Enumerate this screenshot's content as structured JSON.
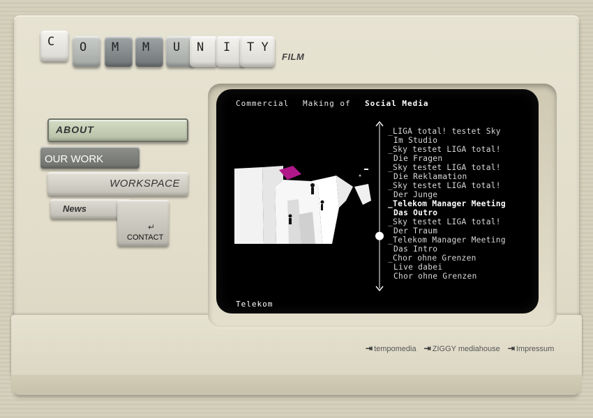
{
  "logo": {
    "letters": [
      "C",
      "O",
      "M",
      "M",
      "U",
      "N",
      "I",
      "T",
      "Y"
    ],
    "film": "FILM"
  },
  "nav": {
    "about": "ABOUT",
    "our_work": "OUR WORK",
    "workspace": "WORKSPACE",
    "news": "News",
    "contact": "CONTACT",
    "enter_glyph": "↵"
  },
  "screen": {
    "tabs": [
      "Commercial",
      "Making of",
      "Social Media"
    ],
    "active_tab": "Social Media",
    "caption": "Telekom",
    "playlist": [
      {
        "title": "_LIGA total! testet Sky",
        "sub": "Im Studio"
      },
      {
        "title": "_Sky testet LIGA total!",
        "sub": "Die Fragen"
      },
      {
        "title": "_Sky testet LIGA total!",
        "sub": "Die Reklamation"
      },
      {
        "title": "_Sky testet LIGA total!",
        "sub": "Der Junge"
      },
      {
        "title": "_Telekom Manager Meeting",
        "sub": "Das Outro",
        "active": true
      },
      {
        "title": "_Sky testet LIGA total!",
        "sub": "Der Traum"
      },
      {
        "title": "_Telekom Manager Meeting",
        "sub": "Das Intro"
      },
      {
        "title": "_Chor ohne Grenzen",
        "sub": "Live dabei"
      },
      {
        "title": "",
        "sub": "Chor ohne Grenzen"
      }
    ],
    "scroll_position": 0.71,
    "accent_color": "#b0188a"
  },
  "footer": {
    "links": [
      "tempomedia",
      "ZIGGY mediahouse",
      "Impressum"
    ],
    "arrow_glyph": "⇥"
  }
}
